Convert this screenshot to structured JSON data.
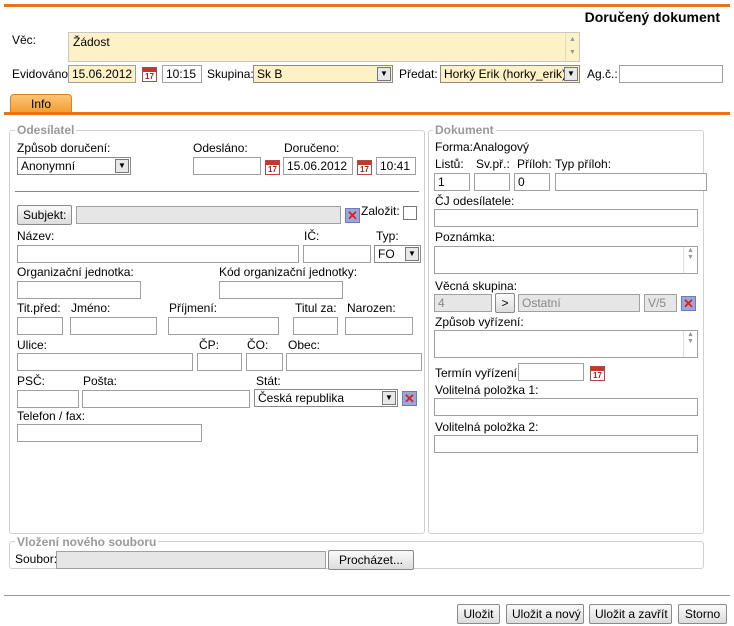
{
  "header": {
    "title": "Doručený dokument"
  },
  "top": {
    "vec_label": "Věc:",
    "vec_value": "Žádost",
    "evidovano_label": "Evidováno:",
    "evidovano_date": "15.06.2012",
    "evidovano_time": "10:15",
    "skupina_label": "Skupina:",
    "skupina_value": "Sk B",
    "predat_label": "Předat:",
    "predat_value": "Horký Erik (horky_erik)",
    "agc_label": "Ag.č.:",
    "agc_value": ""
  },
  "tabs": [
    {
      "label": "Info"
    }
  ],
  "odesilatel": {
    "legend": "Odesílatel",
    "zpusob_label": "Způsob doručení:",
    "zpusob_value": "Anonymní",
    "odeslano_label": "Odesláno:",
    "odeslano_value": "",
    "doruceno_label": "Doručeno:",
    "doruceno_date": "15.06.2012",
    "doruceno_time": "10:41",
    "subjekt_button": "Subjekt:",
    "zalozit_label": "Založit:",
    "nazev_label": "Název:",
    "ic_label": "IČ:",
    "typ_label": "Typ:",
    "typ_value": "FO",
    "org_label": "Organizační jednotka:",
    "kod_org_label": "Kód organizační jednotky:",
    "titpred_label": "Tit.před:",
    "jmeno_label": "Jméno:",
    "prijmeni_label": "Příjmení:",
    "titulza_label": "Titul za:",
    "narozen_label": "Narozen:",
    "ulice_label": "Ulice:",
    "cp_label": "ČP:",
    "co_label": "ČO:",
    "obec_label": "Obec:",
    "psc_label": "PSČ:",
    "posta_label": "Pošta:",
    "stat_label": "Stát:",
    "stat_value": "Česká republika",
    "telefon_label": "Telefon / fax:"
  },
  "dokument": {
    "legend": "Dokument",
    "forma_label": "Forma:",
    "forma_value": "Analogový",
    "listu_label": "Listů:",
    "svpr_label": "Sv.př.:",
    "priloh_label": "Příloh:",
    "typpriloh_label": "Typ příloh:",
    "listu_value": "1",
    "svpr_value": "",
    "priloh_value": "0",
    "cj_label": "ČJ odesílatele:",
    "poznamka_label": "Poznámka:",
    "vecna_label": "Věcná skupina:",
    "vecna_code": "4",
    "vecna_arrow": ">",
    "vecna_name": "Ostatní",
    "vecna_suffix": "V/5",
    "zpusob_vyrizeni_label": "Způsob vyřízení:",
    "termin_label": "Termín vyřízení:",
    "vol1_label": "Volitelná položka 1:",
    "vol2_label": "Volitelná položka 2:"
  },
  "upload": {
    "legend": "Vložení nového souboru",
    "soubor_label": "Soubor:",
    "browse_button": "Procházet..."
  },
  "footer": {
    "ulozit": "Uložit",
    "ulozit_novy": "Uložit a nový",
    "ulozit_zavrit": "Uložit a zavřít",
    "storno": "Storno"
  },
  "icons": {
    "calendar_day": "17"
  },
  "colors": {
    "accent": "#e8731a",
    "field_yellow": "#fdf2c6",
    "tab": "#f7a23c"
  }
}
